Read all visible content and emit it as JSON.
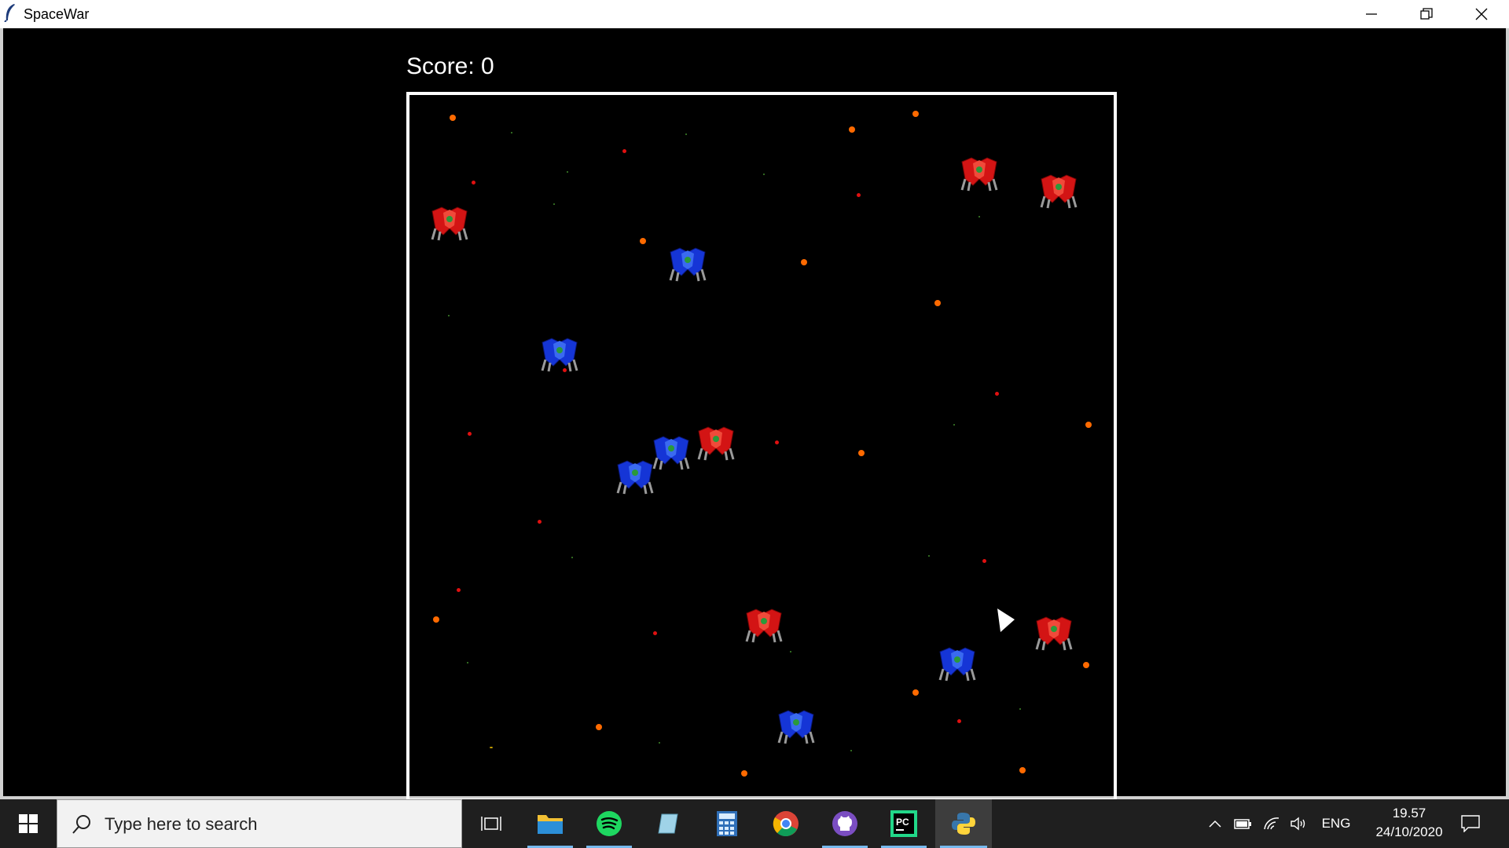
{
  "window": {
    "title": "SpaceWar"
  },
  "game": {
    "score_text": "Score: 0",
    "colors": {
      "background": "#000000",
      "border": "#ffffff",
      "orange_dot": "#ff6a00",
      "red_dot": "#e01010",
      "green_dot": "#3f8a2a",
      "red_enemy": "#d31414",
      "blue_enemy": "#1535d6",
      "player": "#ffffff"
    },
    "enemies": [
      {
        "color": "red"
      },
      {
        "color": "red"
      },
      {
        "color": "red"
      },
      {
        "color": "blue"
      },
      {
        "color": "blue"
      },
      {
        "color": "blue"
      },
      {
        "color": "red"
      },
      {
        "color": "blue"
      },
      {
        "color": "red"
      },
      {
        "color": "red"
      },
      {
        "color": "blue"
      },
      {
        "color": "blue"
      }
    ],
    "player_icon": "player-arrow-icon"
  },
  "taskbar": {
    "search_placeholder": "Type here to search",
    "pinned": [
      "task-view-icon",
      "file-explorer-icon",
      "spotify-icon",
      "notepad-icon",
      "calculator-icon",
      "chrome-icon",
      "github-icon",
      "pycharm-icon",
      "python-icon"
    ],
    "language": "ENG",
    "time": "19.57",
    "date": "24/10/2020"
  }
}
